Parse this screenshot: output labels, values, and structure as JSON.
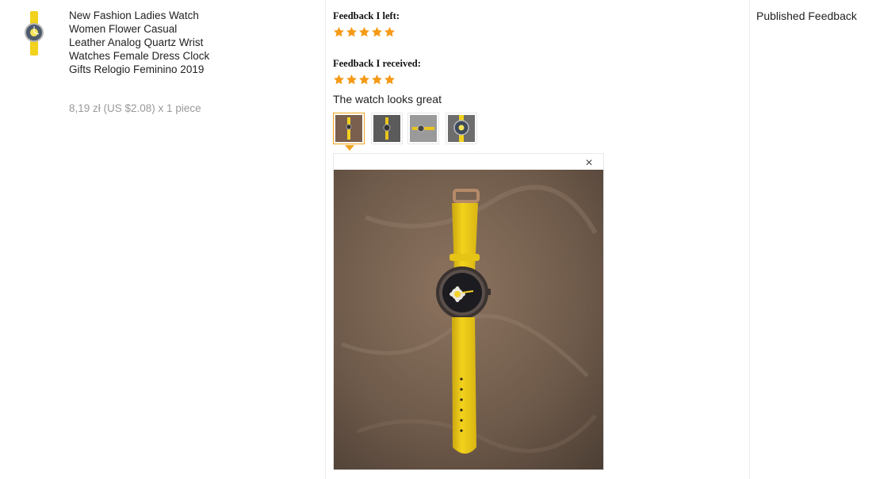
{
  "product": {
    "title": "New Fashion Ladies Watch Women Flower Casual Leather Analog Quartz Wrist Watches Female Dress Clock Gifts Relogio Feminino 2019",
    "price_line": "8,19 zł (US $2.08) x 1 piece",
    "thumbnail_icon": "yellow-watch-thumbnail"
  },
  "feedback": {
    "left_label": "Feedback I left:",
    "left_rating": 5,
    "received_label": "Feedback I received:",
    "received_rating": 5,
    "comment": "The watch looks great",
    "gallery": [
      {
        "icon": "photo-thumb-watch-brown-bg",
        "active": true
      },
      {
        "icon": "photo-thumb-watch-dark-bg",
        "active": false
      },
      {
        "icon": "photo-thumb-watch-grey-bg",
        "active": false
      },
      {
        "icon": "photo-thumb-watch-dial-closeup",
        "active": false
      }
    ],
    "close_symbol": "×"
  },
  "status": {
    "label": "Published Feedback"
  },
  "colors": {
    "star": "#f59a16",
    "accent": "#f0a21e",
    "strap": "#f2d21d"
  }
}
